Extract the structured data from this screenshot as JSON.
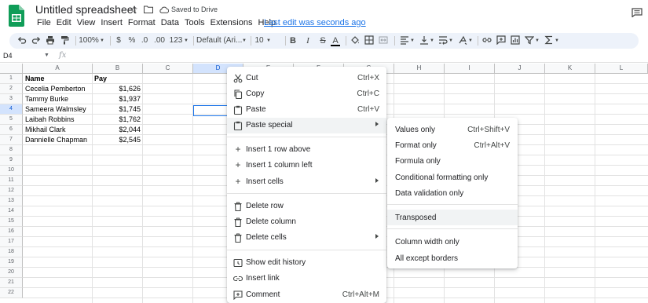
{
  "app": {
    "doc_title": "Untitled spreadsheet",
    "saved_status": "Saved to Drive",
    "last_edit": "Last edit was seconds ago",
    "brand_color": "#0f9d58",
    "accent_color": "#1a73e8"
  },
  "menubar": [
    "File",
    "Edit",
    "View",
    "Insert",
    "Format",
    "Data",
    "Tools",
    "Extensions",
    "Help"
  ],
  "toolbar": {
    "zoom": "100%",
    "currency": "$",
    "percent": "%",
    "decrease_decimal": ".0",
    "increase_decimal": ".00",
    "more_formats": "123",
    "font": "Default (Ari...",
    "font_size": "10",
    "bold": "B",
    "italic": "I",
    "strikethrough": "S",
    "text_color": "A"
  },
  "formula_bar": {
    "cell_ref": "D4",
    "fx": "fx"
  },
  "grid": {
    "columns": [
      "A",
      "B",
      "C",
      "D",
      "E",
      "F",
      "G",
      "H",
      "I",
      "J",
      "K",
      "L"
    ],
    "rows": [
      "1",
      "2",
      "3",
      "4",
      "5",
      "6",
      "7",
      "8",
      "9",
      "10",
      "11",
      "12",
      "13",
      "14",
      "15",
      "16",
      "17",
      "18",
      "19",
      "20",
      "21",
      "22"
    ],
    "headers": {
      "name": "Name",
      "pay": "Pay"
    },
    "data": [
      {
        "name": "Cecelia Pemberton",
        "pay": "$1,626"
      },
      {
        "name": "Tammy Burke",
        "pay": "$1,937"
      },
      {
        "name": "Sameera Walmsley",
        "pay": "$1,745"
      },
      {
        "name": "Laibah Robbins",
        "pay": "$1,762"
      },
      {
        "name": "Mikhail Clark",
        "pay": "$2,044"
      },
      {
        "name": "Dannielle Chapman",
        "pay": "$2,545"
      }
    ]
  },
  "context_menu": {
    "items": [
      {
        "label": "Cut",
        "shortcut": "Ctrl+X",
        "icon": "scissors-icon"
      },
      {
        "label": "Copy",
        "shortcut": "Ctrl+C",
        "icon": "copy-icon"
      },
      {
        "label": "Paste",
        "shortcut": "Ctrl+V",
        "icon": "clipboard-icon"
      },
      {
        "label": "Paste special",
        "shortcut": "",
        "icon": "clipboard-icon"
      },
      {
        "label": "Insert 1 row above",
        "shortcut": "",
        "icon": "plus-icon"
      },
      {
        "label": "Insert 1 column left",
        "shortcut": "",
        "icon": "plus-icon"
      },
      {
        "label": "Insert cells",
        "shortcut": "",
        "icon": "plus-icon"
      },
      {
        "label": "Delete row",
        "shortcut": "",
        "icon": "trash-icon"
      },
      {
        "label": "Delete column",
        "shortcut": "",
        "icon": "trash-icon"
      },
      {
        "label": "Delete cells",
        "shortcut": "",
        "icon": "trash-icon"
      },
      {
        "label": "Show edit history",
        "shortcut": "",
        "icon": "history-icon"
      },
      {
        "label": "Insert link",
        "shortcut": "",
        "icon": "link-icon"
      },
      {
        "label": "Comment",
        "shortcut": "Ctrl+Alt+M",
        "icon": "comment-add-icon"
      }
    ]
  },
  "submenu": {
    "items": [
      {
        "label": "Values only",
        "shortcut": "Ctrl+Shift+V"
      },
      {
        "label": "Format only",
        "shortcut": "Ctrl+Alt+V"
      },
      {
        "label": "Formula only",
        "shortcut": ""
      },
      {
        "label": "Conditional formatting only",
        "shortcut": ""
      },
      {
        "label": "Data validation only",
        "shortcut": ""
      },
      {
        "label": "Transposed",
        "shortcut": ""
      },
      {
        "label": "Column width only",
        "shortcut": ""
      },
      {
        "label": "All except borders",
        "shortcut": ""
      }
    ]
  }
}
